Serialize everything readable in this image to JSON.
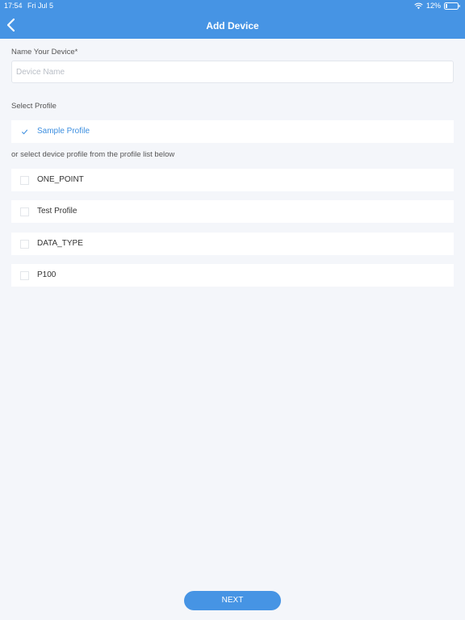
{
  "status_bar": {
    "time": "17:54",
    "date": "Fri Jul 5",
    "battery": "12%"
  },
  "header": {
    "title": "Add Device",
    "back_icon": "chevron-left-icon"
  },
  "form": {
    "name_label": "Name Your Device*",
    "name_placeholder": "Device Name",
    "name_value": "",
    "select_profile_label": "Select Profile",
    "selected_profile": {
      "label": "Sample Profile",
      "checked": true
    },
    "profile_list_hint": "or select device profile from the profile list below",
    "profiles": [
      {
        "label": "ONE_POINT",
        "checked": false
      },
      {
        "label": "Test Profile",
        "checked": false
      },
      {
        "label": "DATA_TYPE",
        "checked": false
      },
      {
        "label": "P100",
        "checked": false
      }
    ]
  },
  "footer": {
    "next_label": "NEXT"
  },
  "colors": {
    "accent": "#4694e4",
    "selected_text": "#3d8fe0",
    "background": "#f4f6fa"
  }
}
